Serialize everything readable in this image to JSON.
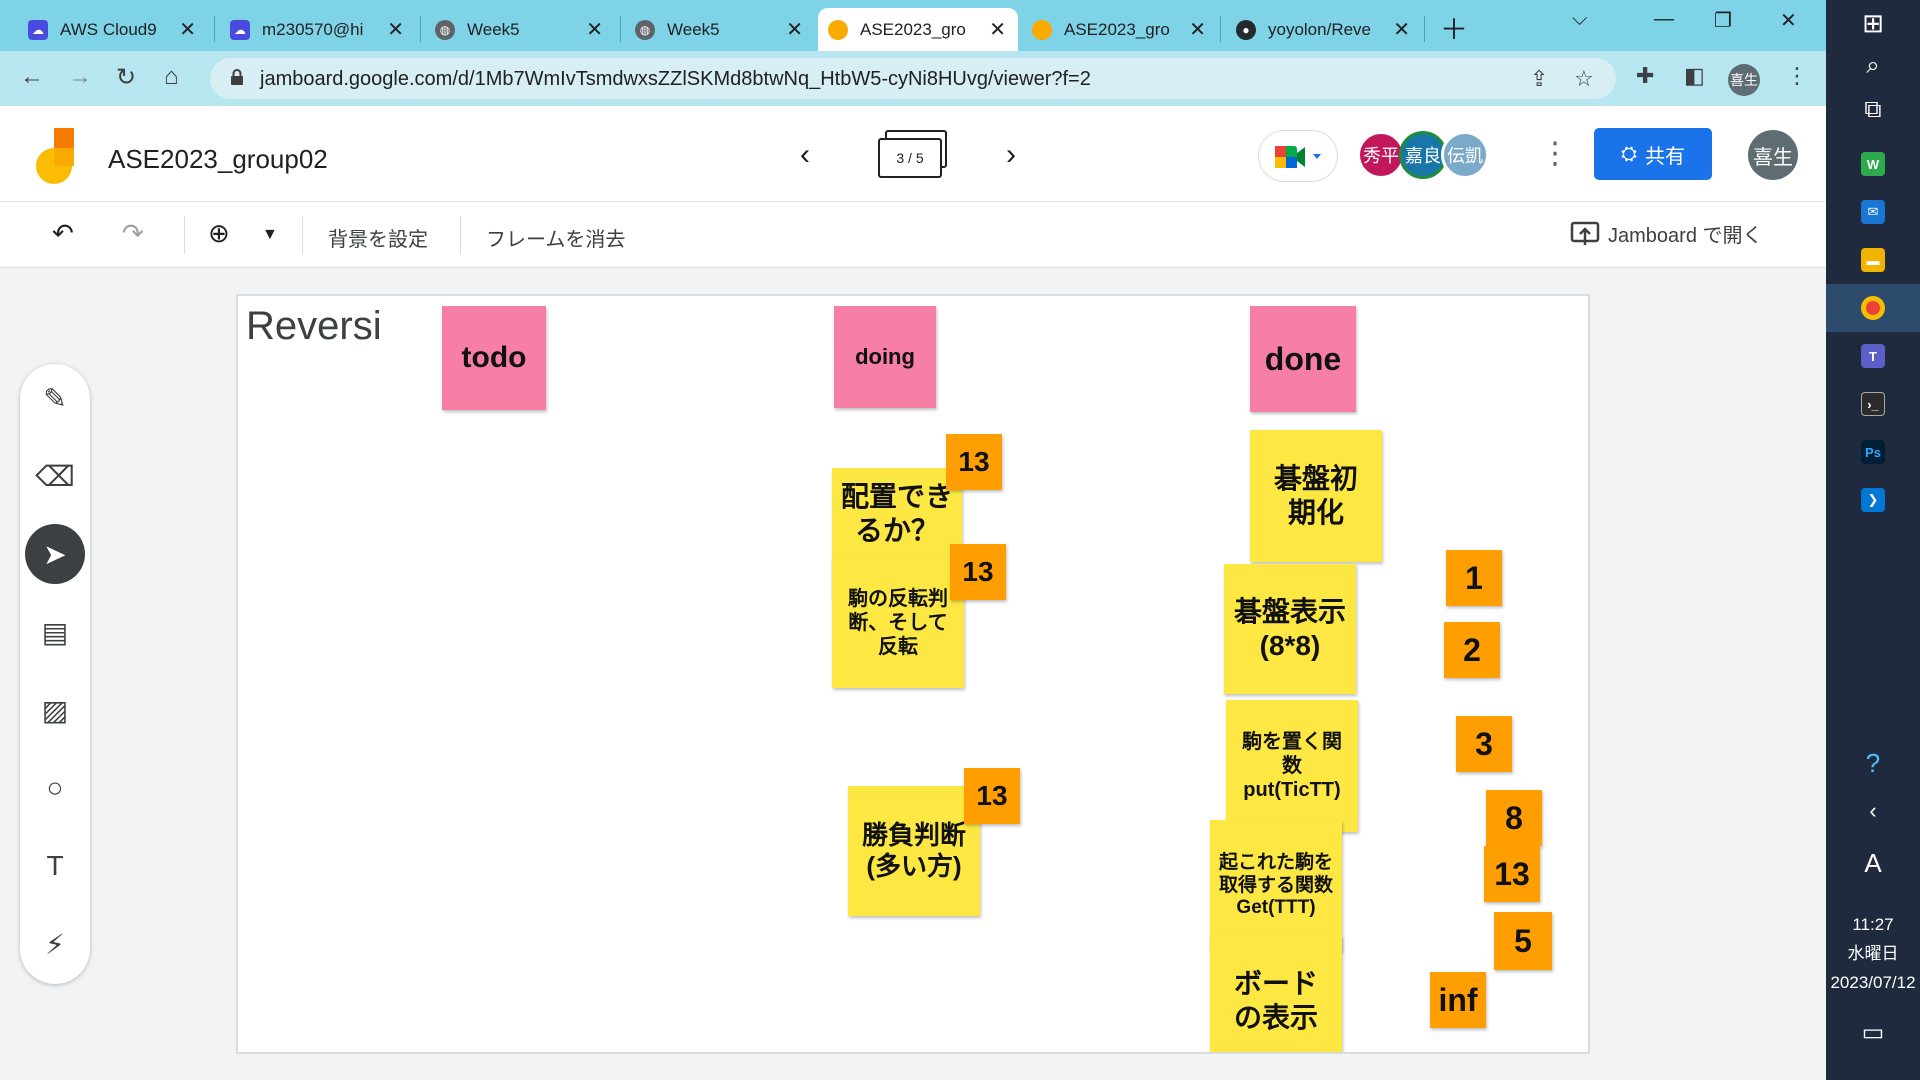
{
  "browser": {
    "tabs": [
      {
        "label": "AWS Cloud9",
        "icon": "cloud9-icon"
      },
      {
        "label": "m230570@hi",
        "icon": "cloud9-icon"
      },
      {
        "label": "Week5",
        "icon": "globe-icon"
      },
      {
        "label": "Week5",
        "icon": "globe-icon"
      },
      {
        "label": "ASE2023_gro",
        "icon": "jamboard-icon",
        "active": true
      },
      {
        "label": "ASE2023_gro",
        "icon": "jamboard-icon"
      },
      {
        "label": "yoyolon/Reve",
        "icon": "github-icon"
      }
    ],
    "url": "jamboard.google.com/d/1Mb7WmIvTsmdwxsZZlSKMd8btwNq_HtbW5-cyNi8HUvg/viewer?f=2",
    "profile_initial": "喜生"
  },
  "header": {
    "title": "ASE2023_group02",
    "frame_indicator": "3 / 5",
    "collaborators": [
      {
        "name": "秀平",
        "color": "#c2185b"
      },
      {
        "name": "嘉良",
        "color": "#1976a8"
      },
      {
        "name": "伝凱",
        "color": "#7aaac8"
      }
    ],
    "share_label": "共有",
    "user_initial": "喜生"
  },
  "toolbar": {
    "set_background": "背景を設定",
    "clear_frame": "フレームを消去",
    "open_in_jamboard": "Jamboard で開く"
  },
  "board": {
    "title": "Reversi",
    "headers": {
      "todo": "todo",
      "doing": "doing",
      "done": "done"
    },
    "doing_notes": {
      "placeable": "配置できるか？",
      "flip": "駒の反転判断、そして反転",
      "winner": "勝負判断(多い方)"
    },
    "done_notes": {
      "init": "碁盤初期化",
      "display": "碁盤表示(8*8)",
      "put": "駒を置く関数put(TicTT)",
      "get": "起これた駒を取得する関数Get(TTT)",
      "board": "ボードの表示"
    },
    "estimates": {
      "placeable": "13",
      "flip": "13",
      "winner": "13",
      "e1": "1",
      "e2": "2",
      "e3": "3",
      "e8": "8",
      "e13": "13",
      "e5": "5",
      "inf": "inf"
    }
  },
  "taskbar": {
    "time": "11:27",
    "weekday": "水曜日",
    "date": "2023/07/12",
    "ime": "A"
  }
}
